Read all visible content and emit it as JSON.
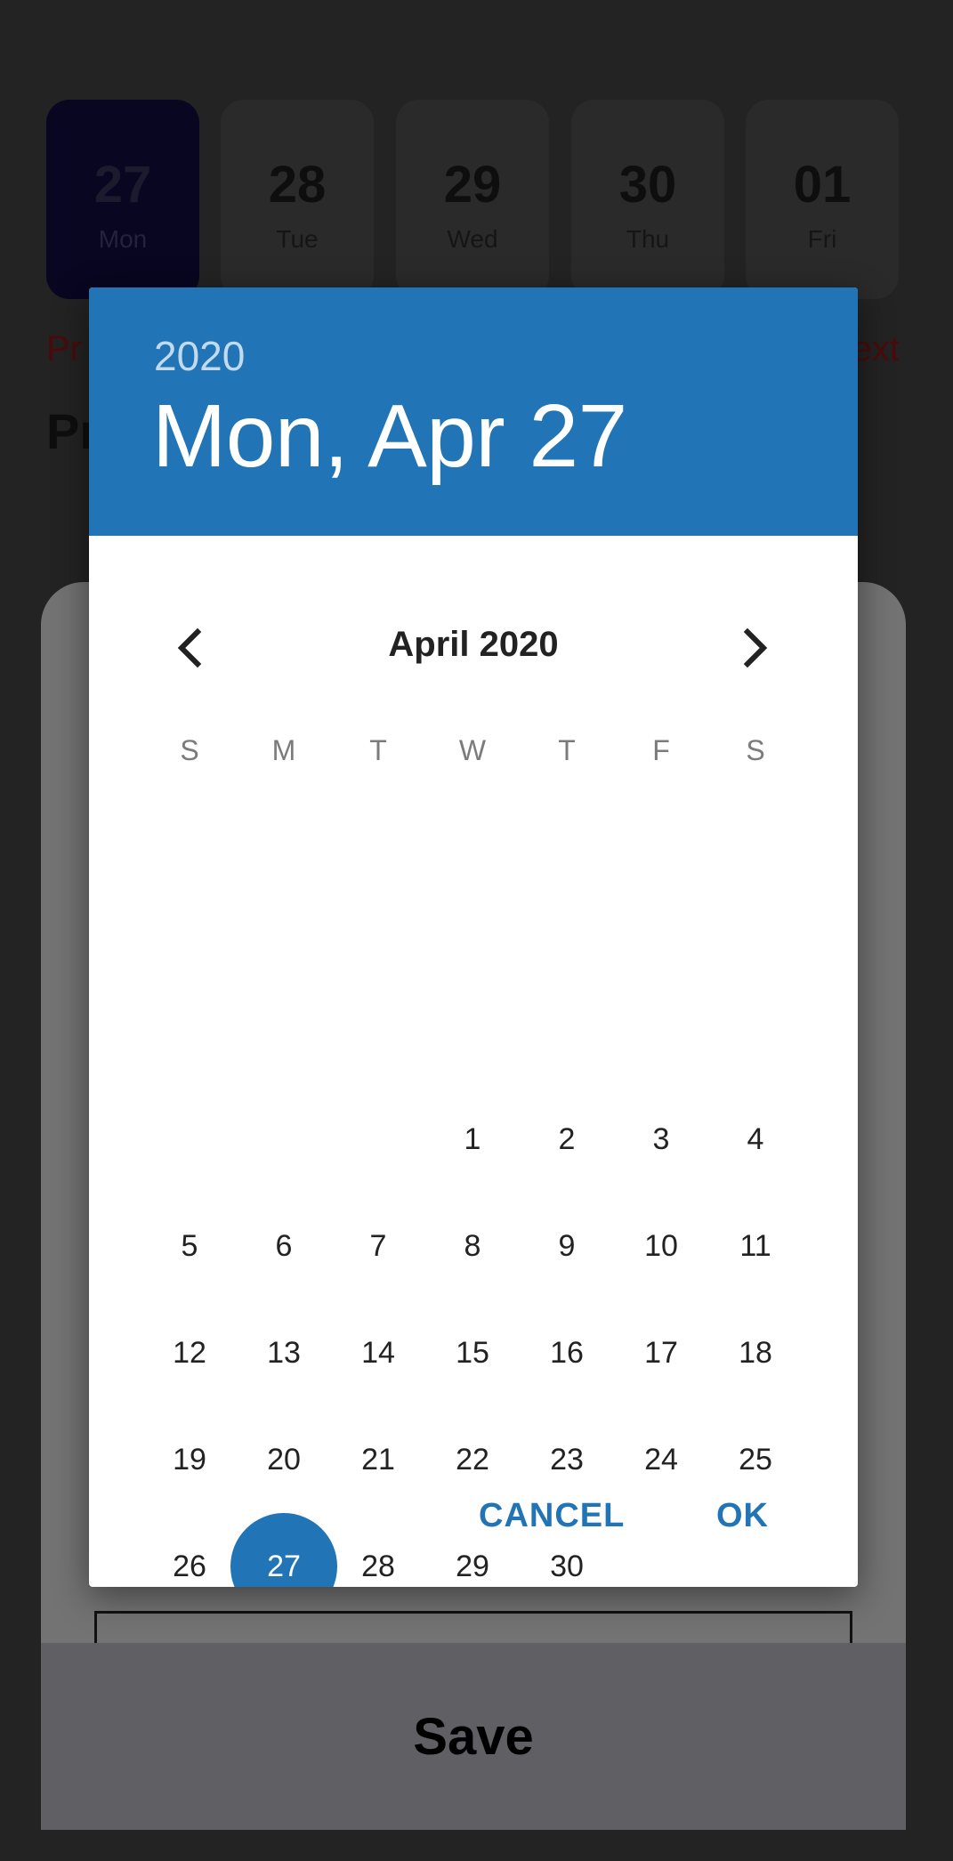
{
  "background": {
    "date_strip": [
      {
        "num": "27",
        "dow": "Mon",
        "selected": true
      },
      {
        "num": "28",
        "dow": "Tue",
        "selected": false
      },
      {
        "num": "29",
        "dow": "Wed",
        "selected": false
      },
      {
        "num": "30",
        "dow": "Thu",
        "selected": false
      },
      {
        "num": "01",
        "dow": "Fri",
        "selected": false
      }
    ],
    "prev_label": "Pr",
    "next_label": "ext",
    "heading": "Pr",
    "save_label": "Save"
  },
  "dialog": {
    "year": "2020",
    "selected_date": "Mon, Apr 27",
    "month_label": "April 2020",
    "weekdays": [
      "S",
      "M",
      "T",
      "W",
      "T",
      "F",
      "S"
    ],
    "first_weekday_index": 3,
    "days_in_month": 30,
    "selected_day": 27,
    "cancel_label": "CANCEL",
    "ok_label": "OK",
    "accent_color": "#2174b5",
    "prev_icon": "chevron-left-icon",
    "next_icon": "chevron-right-icon"
  }
}
